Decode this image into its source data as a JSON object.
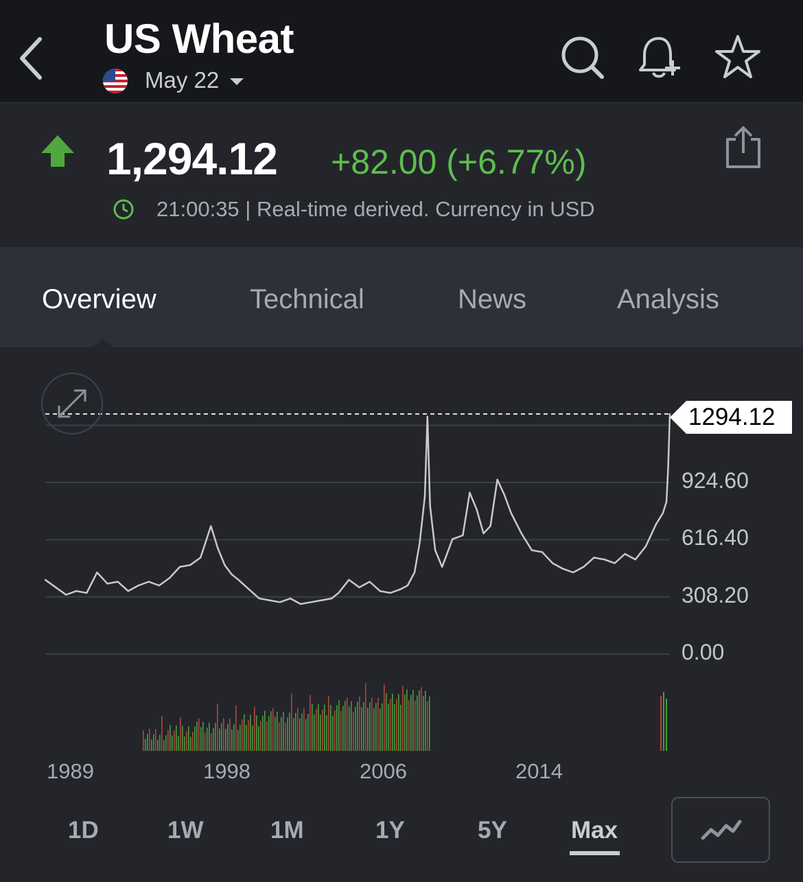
{
  "header": {
    "title": "US Wheat",
    "contract": "May 22"
  },
  "quote": {
    "price": "1,294.12",
    "change": "+82.00 (+6.77%)",
    "info": "21:00:35 | Real-time derived. Currency in USD"
  },
  "tabs": [
    "Overview",
    "Technical",
    "News",
    "Analysis"
  ],
  "chart": {
    "current_price_label": "1294.12",
    "y_labels": [
      "924.60",
      "616.40",
      "308.20",
      "0.00"
    ],
    "x_labels": [
      "1989",
      "1998",
      "2006",
      "2014"
    ]
  },
  "ranges": [
    "1D",
    "1W",
    "1M",
    "1Y",
    "5Y",
    "Max"
  ],
  "colors": {
    "up": "#5dbe4e",
    "background": "#23252b",
    "header": "#16171b",
    "tabs": "#2d3038"
  },
  "chart_data": {
    "type": "line",
    "ylim": [
      0,
      1294.12
    ],
    "yticks": [
      0,
      308.2,
      616.4,
      924.6
    ],
    "xticks": [
      1989,
      1998,
      2006,
      2014
    ],
    "current_value": 1294.12,
    "series": [
      {
        "x": [
          1986.0,
          1986.6,
          1987.2,
          1987.8,
          1988.4,
          1989.0,
          1989.6,
          1990.2,
          1990.8,
          1991.4,
          1992.0,
          1992.6,
          1993.2,
          1993.8,
          1994.4,
          1995.0,
          1995.6,
          1996.0,
          1996.4,
          1996.8,
          1997.2,
          1997.8,
          1998.4,
          1999.0,
          1999.6,
          2000.2,
          2000.8,
          2001.4,
          2002.0,
          2002.6,
          2003.0,
          2003.6,
          2004.2,
          2004.8,
          2005.4,
          2006.0,
          2006.6,
          2007.0,
          2007.4,
          2007.7,
          2008.0,
          2008.15,
          2008.3,
          2008.6,
          2009.0,
          2009.6,
          2010.2,
          2010.6,
          2011.0,
          2011.4,
          2011.8,
          2012.2,
          2012.6,
          2013.0,
          2013.6,
          2014.2,
          2014.8,
          2015.4,
          2016.0,
          2016.6,
          2017.2,
          2017.8,
          2018.4,
          2019.0,
          2019.6,
          2020.2,
          2020.8,
          2021.4,
          2021.8,
          2022.0,
          2022.1,
          2022.2
        ],
        "values": [
          400,
          360,
          320,
          340,
          330,
          440,
          380,
          390,
          340,
          370,
          390,
          370,
          410,
          470,
          480,
          520,
          690,
          570,
          480,
          430,
          400,
          350,
          300,
          290,
          280,
          300,
          270,
          280,
          290,
          300,
          330,
          400,
          360,
          390,
          340,
          330,
          350,
          370,
          440,
          600,
          850,
          1280,
          800,
          560,
          470,
          620,
          640,
          870,
          780,
          650,
          690,
          940,
          860,
          760,
          650,
          560,
          550,
          490,
          460,
          440,
          470,
          520,
          510,
          490,
          540,
          510,
          580,
          700,
          760,
          820,
          1000,
          1294.12
        ]
      }
    ]
  }
}
